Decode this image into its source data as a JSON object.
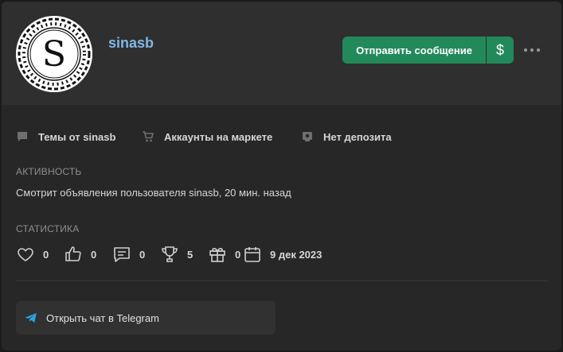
{
  "profile": {
    "username": "sinasb",
    "avatar_letter": "S",
    "avatar_icon": "ornamental-seal-avatar"
  },
  "actions": {
    "send_message_label": "Отправить сообщение",
    "money_label": "$",
    "more_icon": "more-dots-icon"
  },
  "links": [
    {
      "label": "Темы от sinasb",
      "icon": "chat-bubble-icon"
    },
    {
      "label": "Аккаунты на маркете",
      "icon": "cart-icon"
    },
    {
      "label": "Нет депозита",
      "icon": "deposit-icon"
    }
  ],
  "activity": {
    "title": "Активность",
    "text": "Смотрит объявления пользователя sinasb, 20 мин. назад"
  },
  "stats": {
    "title": "Статистика",
    "items": [
      {
        "icon": "heart-icon",
        "value": "0"
      },
      {
        "icon": "thumbs-up-icon",
        "value": "0"
      },
      {
        "icon": "comment-icon",
        "value": "0"
      },
      {
        "icon": "trophy-icon",
        "value": "5"
      },
      {
        "icon": "gift-icon",
        "value": "0"
      },
      {
        "icon": "calendar-icon",
        "value": "9 дек 2023"
      }
    ]
  },
  "telegram": {
    "label": "Открыть чат в Telegram",
    "icon": "telegram-icon"
  },
  "colors": {
    "accent_green": "#22895a",
    "username_blue": "#7fb8e6",
    "telegram_blue": "#2aa3e6"
  }
}
